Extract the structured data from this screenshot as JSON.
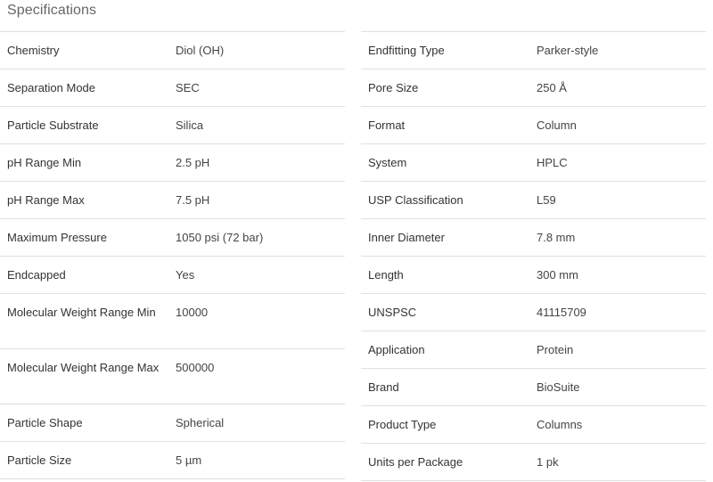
{
  "section": {
    "title": "Specifications"
  },
  "left_specs": [
    {
      "label": "Chemistry",
      "value": "Diol (OH)"
    },
    {
      "label": "Separation Mode",
      "value": "SEC"
    },
    {
      "label": "Particle Substrate",
      "value": "Silica"
    },
    {
      "label": "pH Range Min",
      "value": "2.5 pH"
    },
    {
      "label": "pH Range Max",
      "value": "7.5 pH"
    },
    {
      "label": "Maximum Pressure",
      "value": "1050 psi (72 bar)"
    },
    {
      "label": "Endcapped",
      "value": "Yes"
    },
    {
      "label": "Molecular Weight Range Min",
      "value": "10000"
    },
    {
      "label": "Molecular Weight Range Max",
      "value": "500000"
    },
    {
      "label": "Particle Shape",
      "value": "Spherical"
    },
    {
      "label": "Particle Size",
      "value": "5 µm"
    }
  ],
  "right_specs": [
    {
      "label": "Endfitting Type",
      "value": "Parker-style"
    },
    {
      "label": "Pore Size",
      "value": "250 Å"
    },
    {
      "label": "Format",
      "value": "Column"
    },
    {
      "label": "System",
      "value": "HPLC"
    },
    {
      "label": "USP Classification",
      "value": "L59"
    },
    {
      "label": "Inner Diameter",
      "value": "7.8 mm"
    },
    {
      "label": "Length",
      "value": "300 mm"
    },
    {
      "label": "UNSPSC",
      "value": "41115709"
    },
    {
      "label": "Application",
      "value": "Protein"
    },
    {
      "label": "Brand",
      "value": "BioSuite"
    },
    {
      "label": "Product Type",
      "value": "Columns"
    },
    {
      "label": "Units per Package",
      "value": "1 pk"
    }
  ]
}
